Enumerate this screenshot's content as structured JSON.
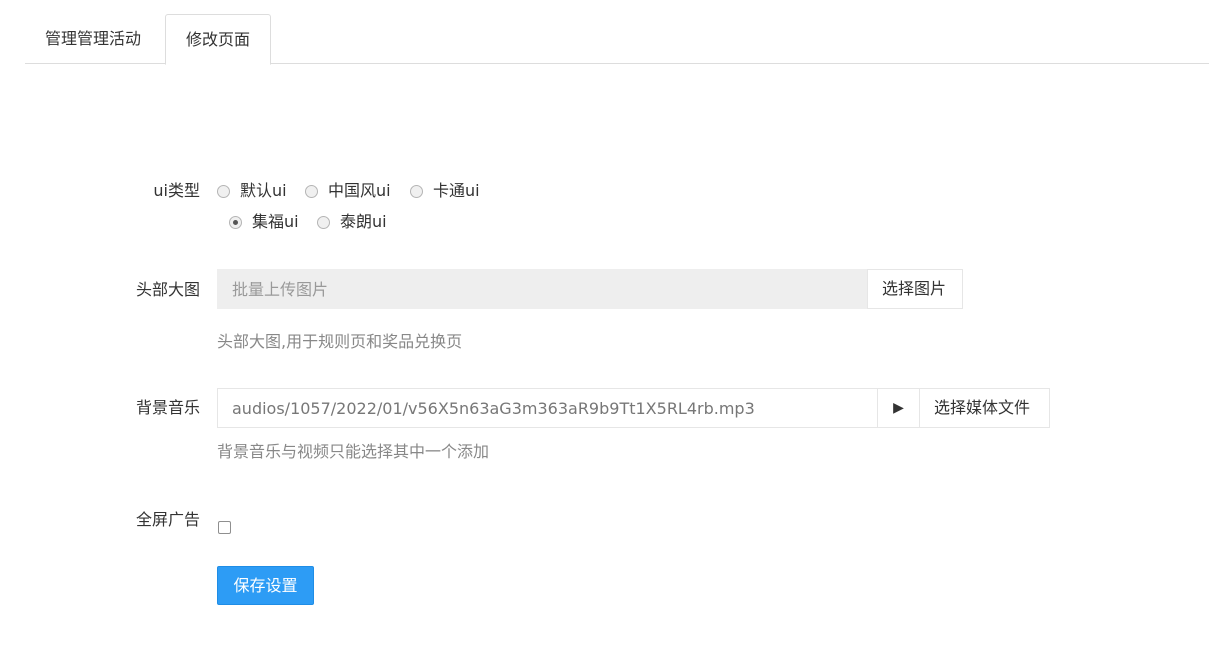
{
  "tabs": [
    {
      "label": "管理管理活动",
      "active": false
    },
    {
      "label": "修改页面",
      "active": true
    }
  ],
  "form": {
    "ui_type": {
      "label": "ui类型",
      "options": [
        {
          "label": "默认ui",
          "checked": false
        },
        {
          "label": "中国风ui",
          "checked": false
        },
        {
          "label": "卡通ui",
          "checked": false
        },
        {
          "label": "集福ui",
          "checked": true
        },
        {
          "label": "泰朗ui",
          "checked": false
        }
      ]
    },
    "banner": {
      "label": "头部大图",
      "placeholder": "批量上传图片",
      "value": "",
      "button": "选择图片",
      "help": "头部大图,用于规则页和奖品兑换页"
    },
    "music": {
      "label": "背景音乐",
      "value": "audios/1057/2022/01/v56X5n63aG3m363aR9b9Tt1X5RL4rb.mp3",
      "play_icon": "play-icon",
      "play_glyph": "▶",
      "button": "选择媒体文件",
      "help": "背景音乐与视频只能选择其中一个添加"
    },
    "fullscreen_ad": {
      "label": "全屏广告",
      "checked": false
    },
    "save_button": "保存设置"
  },
  "colors": {
    "primary": "#2d9cf5",
    "border": "#dddddd",
    "help_text": "#888888"
  }
}
